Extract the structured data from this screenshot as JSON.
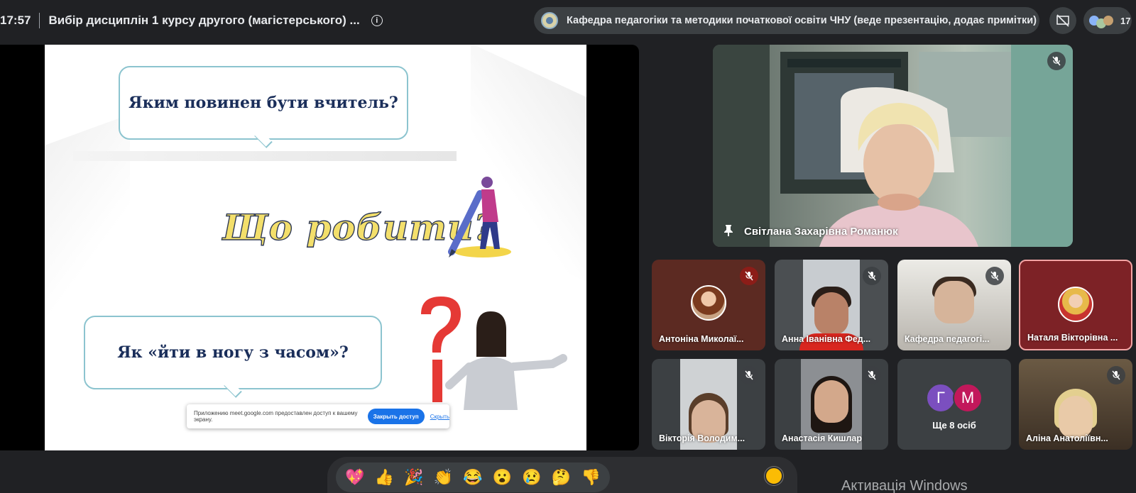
{
  "header": {
    "time": "17:57",
    "meeting_title": "Вибір дисциплін 1 курсу другого (магістерського) ...",
    "presenter_chip": "Кафедра педагогіки та методики початкової освіти ЧНУ (веде презентацію, додає примітки)",
    "participant_count": "17"
  },
  "slide": {
    "question_1": "Яким повинен бути вчитель?",
    "script_text": "Що робити?",
    "question_2": "Як  «йти в ногу з часом»?"
  },
  "share_notice": {
    "text": "Приложению meet.google.com предоставлен доступ к вашему экрану.",
    "stop_button": "Закрыть доступ",
    "hide_link": "Скрыть"
  },
  "speaker": {
    "name": "Світлана Захарівна Романюк"
  },
  "participants": [
    {
      "name": "Антоніна Миколаї..."
    },
    {
      "name": "Анна Іванівна Фед..."
    },
    {
      "name": "Кафедра педагогі..."
    },
    {
      "name": "Наталя Вікторівна ..."
    },
    {
      "name": "Вікторія Володим..."
    },
    {
      "name": "Анастасія Кишлар"
    },
    {
      "name": "Аліна Анатоліївн..."
    }
  ],
  "others_tile": {
    "initial_1": "Г",
    "initial_2": "М",
    "label": "Ще 8 осіб"
  },
  "reactions": {
    "emojis": [
      "💖",
      "👍",
      "🎉",
      "👏",
      "😂",
      "😮",
      "😢",
      "🤔",
      "👎"
    ],
    "skin_tone_color": "#fbbc04"
  },
  "os_watermark": "Активація Windows"
}
